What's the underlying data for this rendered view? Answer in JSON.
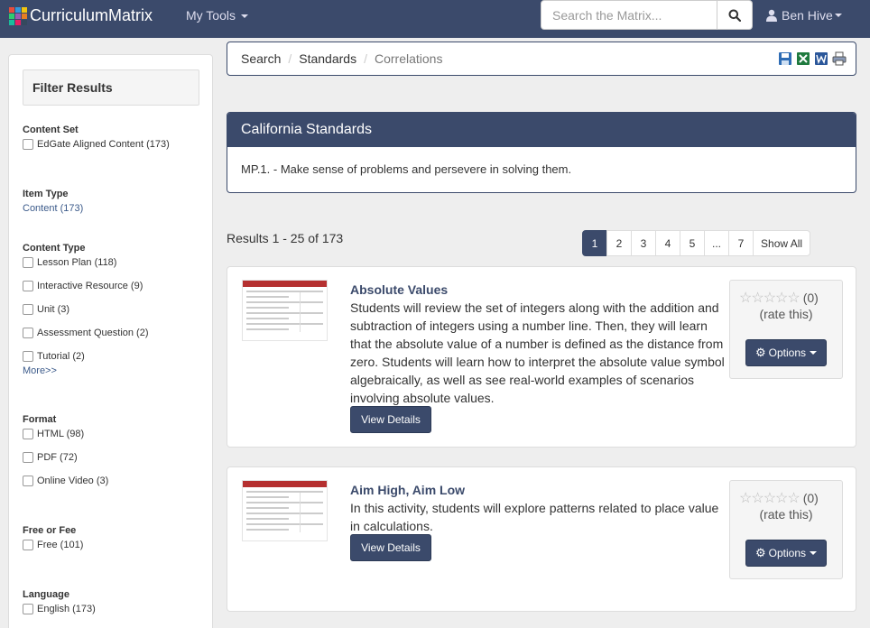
{
  "navbar": {
    "brand": "CurriculumMatrix",
    "logo_colors": [
      "#e74c3c",
      "#3498db",
      "#f1c40f",
      "#2ecc71",
      "#9b59b6",
      "#e67e22",
      "#1abc9c",
      "#e91e63",
      "#34495e"
    ],
    "my_tools": "My Tools",
    "search_placeholder": "Search the Matrix...",
    "user": "Ben Hive",
    "bg_color": "#3b4a6b"
  },
  "sidebar": {
    "header": "Filter Results",
    "content_set": {
      "label": "Content Set",
      "options": [
        {
          "label": "EdGate Aligned Content (173)"
        }
      ]
    },
    "item_type": {
      "label": "Item Type",
      "value": "Content (173)"
    },
    "content_type": {
      "label": "Content Type",
      "options": [
        {
          "label": "Lesson Plan (118)"
        },
        {
          "label": "Interactive Resource (9)"
        },
        {
          "label": "Unit (3)"
        },
        {
          "label": "Assessment Question (2)"
        },
        {
          "label": "Tutorial (2)"
        }
      ],
      "more": "More>>"
    },
    "format": {
      "label": "Format",
      "options": [
        {
          "label": "HTML (98)"
        },
        {
          "label": "PDF (72)"
        },
        {
          "label": "Online Video (3)"
        }
      ]
    },
    "free_or_fee": {
      "label": "Free or Fee",
      "options": [
        {
          "label": "Free (101)"
        }
      ]
    },
    "language": {
      "label": "Language",
      "options": [
        {
          "label": "English (173)"
        }
      ]
    }
  },
  "breadcrumb": {
    "items": [
      "Search",
      "Standards",
      "Correlations"
    ]
  },
  "toolbar_icons": [
    "save-icon",
    "excel-icon",
    "word-icon",
    "print-icon"
  ],
  "standard_panel": {
    "title": "California Standards",
    "body": "MP.1. - Make sense of problems and persevere in solving them."
  },
  "results": {
    "summary": "Results 1 - 25 of 173",
    "pagination": [
      "1",
      "2",
      "3",
      "4",
      "5",
      "...",
      "7",
      "Show All"
    ],
    "active_page": "1",
    "items": [
      {
        "title": "Absolute Values",
        "description": "Students will review the set of integers along with the addition and subtraction of integers using a number line. Then, they will learn that the absolute value of a number is defined as the distance from zero. Students will learn how to interpret the absolute value symbol algebraically, as well as see real-world examples of scenarios involving absolute values.",
        "details_label": "View Details",
        "rating_count": "(0)",
        "rate_label": "(rate this)",
        "options_label": "Options"
      },
      {
        "title": "Aim High, Aim Low",
        "description": "In this activity, students will explore patterns related to place value in calculations.",
        "details_label": "View Details",
        "rating_count": "(0)",
        "rate_label": "(rate this)",
        "options_label": "Options"
      }
    ]
  }
}
